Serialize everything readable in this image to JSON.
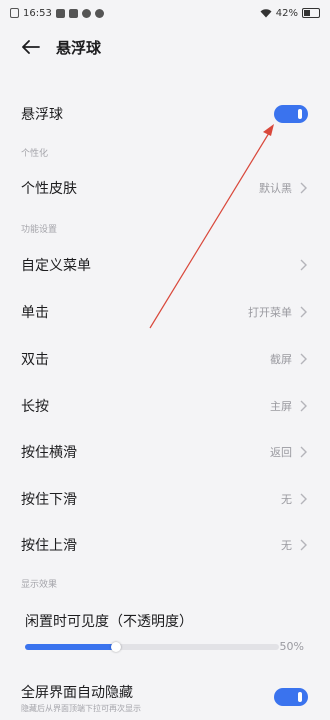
{
  "status_bar": {
    "time": "16:53",
    "battery": "42%"
  },
  "header": {
    "title": "悬浮球"
  },
  "main_toggle": {
    "label": "悬浮球",
    "on": true
  },
  "sections": {
    "personalize": "个性化",
    "function": "功能设置",
    "display": "显示效果"
  },
  "rows": {
    "skin": {
      "label": "个性皮肤",
      "value": "默认黑"
    },
    "custom_menu": {
      "label": "自定义菜单",
      "value": ""
    },
    "single_tap": {
      "label": "单击",
      "value": "打开菜单"
    },
    "double_tap": {
      "label": "双击",
      "value": "截屏"
    },
    "long_press": {
      "label": "长按",
      "value": "主屏"
    },
    "hold_horizontal": {
      "label": "按住横滑",
      "value": "返回"
    },
    "hold_down": {
      "label": "按住下滑",
      "value": "无"
    },
    "hold_up": {
      "label": "按住上滑",
      "value": "无"
    }
  },
  "opacity": {
    "label": "闲置时可见度（不透明度）",
    "value_text": "50%",
    "level": 0.36
  },
  "auto_hide": {
    "title": "全屏界面自动隐藏",
    "subtitle": "隐藏后从界面顶端下拉可再次显示",
    "on": true
  },
  "colors": {
    "accent": "#3a73ee",
    "annotation": "#d9483b"
  }
}
